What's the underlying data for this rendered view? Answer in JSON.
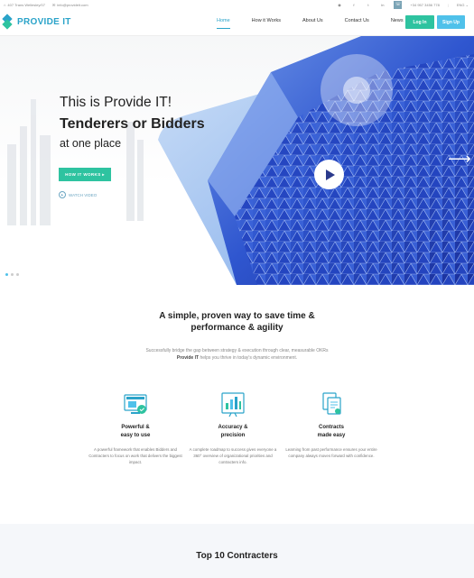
{
  "topbar": {
    "address": "407 Trans Wellesley/07",
    "email": "info@provideit.com",
    "social": [
      "pinterest-icon",
      "facebook-icon",
      "twitter-icon",
      "linkedin-icon"
    ],
    "phone": "+34 957 3456 778",
    "lang": "ENG"
  },
  "header": {
    "logo_text": "PROVIDE IT",
    "nav": [
      "Home",
      "How it Works",
      "About Us",
      "Contact Us",
      "News"
    ],
    "login": "Log In",
    "signup": "Sign Up"
  },
  "hero": {
    "subtitle": "This is Provide IT!",
    "title": "Tenderers or Bidders",
    "title2": "at one place",
    "cta": "HOW IT WORKS ▸",
    "watch": "WATCH VIDEO",
    "slides": 3,
    "active_slide": 1
  },
  "intro": {
    "title": "A simple, proven way to save time & performance & agility",
    "desc": "Successfully bridge the gap between strategy & execution through clear, measurable OKRs",
    "desc_bold": "Provide IT",
    "desc_tail": "helps you thrive in today's dynamic environment."
  },
  "features": [
    {
      "icon": "framework-icon",
      "title1": "Powerful &",
      "title2": "easy to use",
      "desc": "A powerful framework that enables Bidders and Contracters to focus on work that delivers the biggest impact."
    },
    {
      "icon": "analytics-board-icon",
      "title1": "Accuracy &",
      "title2": "precision",
      "desc": "A complete roadmap to success gives everyone a 360° overview of organizational priorities and contracters info."
    },
    {
      "icon": "contracts-icon",
      "title1": "Contracts",
      "title2": "made easy",
      "desc": "Learning from past performance ensures your entire company always moves forward with confidence."
    }
  ],
  "contractors": {
    "title": "Top 10 Contracters"
  },
  "colors": {
    "primary": "#2aa3c9",
    "green": "#2ec3a0",
    "blue": "#4fc1ea",
    "building": "#2b4ec8"
  }
}
